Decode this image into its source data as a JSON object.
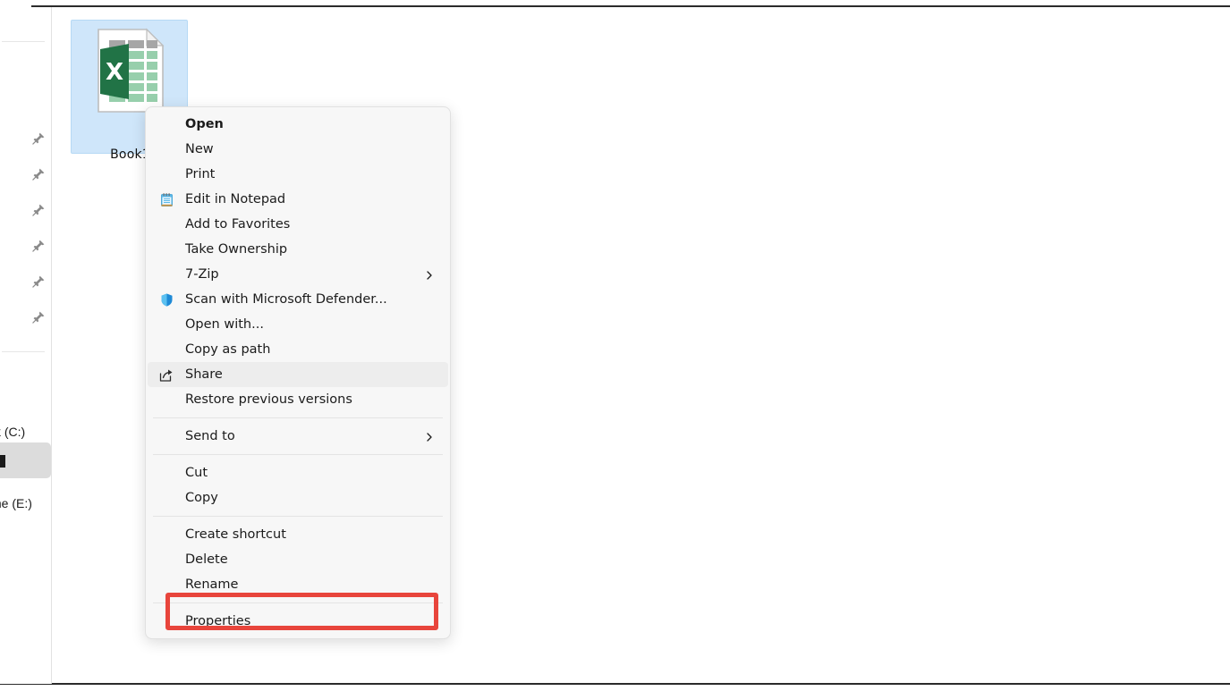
{
  "desktop": {
    "file": {
      "name": "Book1",
      "icon": "excel-file-icon",
      "selected": true
    }
  },
  "nav_pane": {
    "pin_icon": "pin-icon",
    "items": [
      {
        "label": ""
      },
      {
        "label": ""
      },
      {
        "label": ""
      },
      {
        "label": ""
      },
      {
        "label": ""
      },
      {
        "label": ""
      }
    ],
    "drives": [
      {
        "label": "k (C:)"
      },
      {
        "label": "me (E:)"
      }
    ]
  },
  "context_menu": {
    "groups": [
      {
        "items": [
          {
            "label": "Open",
            "icon": null,
            "bold": true,
            "submenu": false,
            "highlight": false
          },
          {
            "label": "New",
            "icon": null,
            "bold": false,
            "submenu": false,
            "highlight": false
          },
          {
            "label": "Print",
            "icon": null,
            "bold": false,
            "submenu": false,
            "highlight": false
          },
          {
            "label": "Edit in Notepad",
            "icon": "notepad-icon",
            "bold": false,
            "submenu": false,
            "highlight": false
          },
          {
            "label": "Add to Favorites",
            "icon": null,
            "bold": false,
            "submenu": false,
            "highlight": false
          },
          {
            "label": "Take Ownership",
            "icon": null,
            "bold": false,
            "submenu": false,
            "highlight": false
          },
          {
            "label": "7-Zip",
            "icon": null,
            "bold": false,
            "submenu": true,
            "highlight": false
          },
          {
            "label": "Scan with Microsoft Defender...",
            "icon": "shield-icon",
            "bold": false,
            "submenu": false,
            "highlight": false
          },
          {
            "label": "Open with...",
            "icon": null,
            "bold": false,
            "submenu": false,
            "highlight": false
          },
          {
            "label": "Copy as path",
            "icon": null,
            "bold": false,
            "submenu": false,
            "highlight": false
          },
          {
            "label": "Share",
            "icon": "share-icon",
            "bold": false,
            "submenu": false,
            "highlight": true
          },
          {
            "label": "Restore previous versions",
            "icon": null,
            "bold": false,
            "submenu": false,
            "highlight": false
          }
        ]
      },
      {
        "items": [
          {
            "label": "Send to",
            "icon": null,
            "bold": false,
            "submenu": true,
            "highlight": false
          }
        ]
      },
      {
        "items": [
          {
            "label": "Cut",
            "icon": null,
            "bold": false,
            "submenu": false,
            "highlight": false
          },
          {
            "label": "Copy",
            "icon": null,
            "bold": false,
            "submenu": false,
            "highlight": false
          }
        ]
      },
      {
        "items": [
          {
            "label": "Create shortcut",
            "icon": null,
            "bold": false,
            "submenu": false,
            "highlight": false
          },
          {
            "label": "Delete",
            "icon": null,
            "bold": false,
            "submenu": false,
            "highlight": false
          },
          {
            "label": "Rename",
            "icon": null,
            "bold": false,
            "submenu": false,
            "highlight": false
          }
        ]
      },
      {
        "items": [
          {
            "label": "Properties",
            "icon": null,
            "bold": false,
            "submenu": false,
            "highlight": false
          }
        ]
      }
    ]
  },
  "annotation": {
    "target": "Properties",
    "color": "#e8453c"
  },
  "colors": {
    "selection_blue": "#cfe6fa",
    "menu_background": "#f7f7f7",
    "menu_highlight": "#ededed",
    "excel_green": "#21784b",
    "annotation_red": "#e8453c"
  }
}
